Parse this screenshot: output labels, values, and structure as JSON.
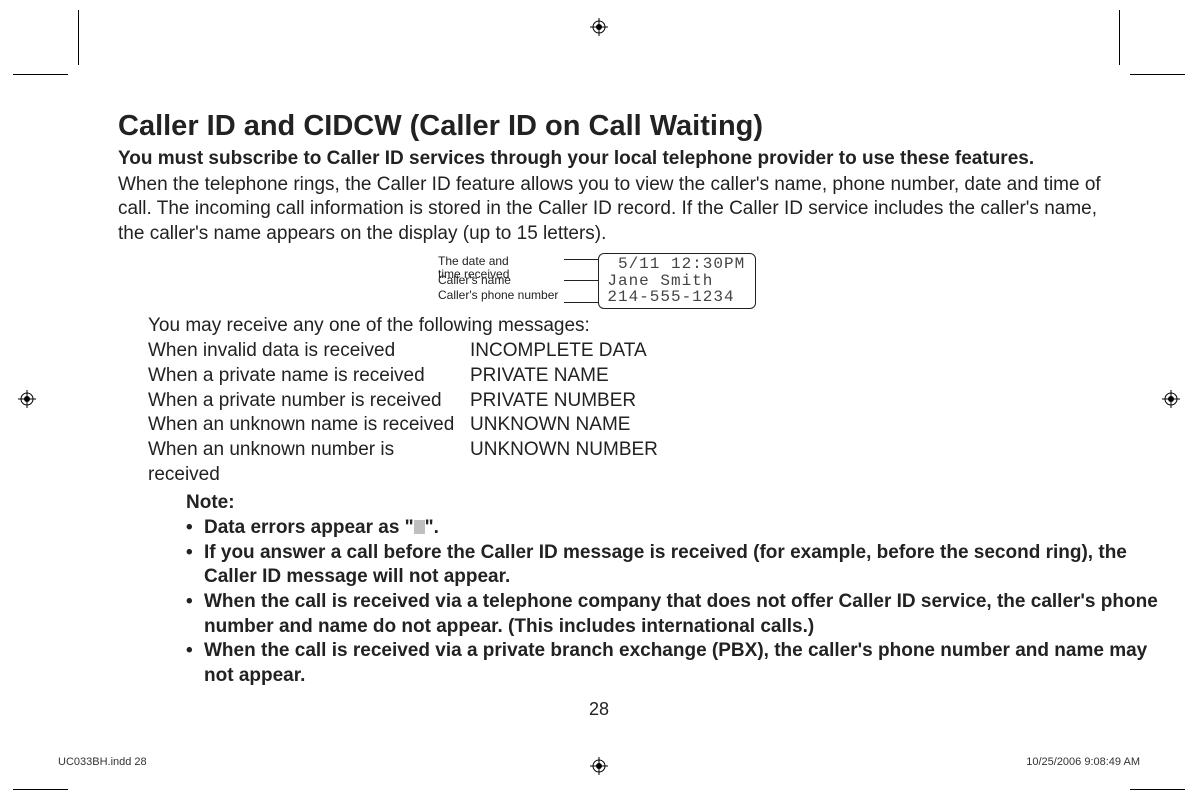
{
  "title": "Caller ID and CIDCW (Caller ID on Call Waiting)",
  "subtitle": "You must subscribe to Caller ID services through your local telephone provider to use these features.",
  "intro": "When the telephone rings, the Caller ID feature allows you to view the caller's name, phone number, date and time of call. The incoming call information is stored in the Caller ID record. If the Caller ID service includes the caller's name, the caller's name appears on the display (up to 15 letters).",
  "diagram": {
    "label_date": "The date and\ntime received",
    "label_name": "Caller's name",
    "label_phone": "Caller's phone number",
    "lcd_line1": " 5/11 12:30PM",
    "lcd_line2": "Jane Smith",
    "lcd_line3": "214-555-1234"
  },
  "messages_intro": "You may receive any one of the following messages:",
  "messages": [
    {
      "when": "When invalid data is received",
      "msg": "INCOMPLETE DATA"
    },
    {
      "when": "When a private name is received",
      "msg": "PRIVATE NAME"
    },
    {
      "when": "When a private number is received",
      "msg": "PRIVATE NUMBER"
    },
    {
      "when": "When an unknown name is received",
      "msg": "UNKNOWN NAME"
    },
    {
      "when": "When an unknown number is received",
      "msg": "UNKNOWN NUMBER"
    }
  ],
  "note": {
    "heading": "Note:",
    "items": [
      {
        "pre": "Data errors appear as \"",
        "post": "\"."
      },
      {
        "text": "If you answer a call before the Caller ID message is received (for example, before the second ring), the Caller ID message will not appear."
      },
      {
        "text": "When the call is received via a telephone company that does not offer Caller ID service, the caller's phone number and name do not appear. (This includes international calls.)"
      },
      {
        "text": "When the call is received via a private branch exchange (PBX), the caller's phone number and name may not appear."
      }
    ]
  },
  "page_number": "28",
  "footer_left": "UC033BH.indd   28",
  "footer_right": "10/25/2006   9:08:49 AM"
}
